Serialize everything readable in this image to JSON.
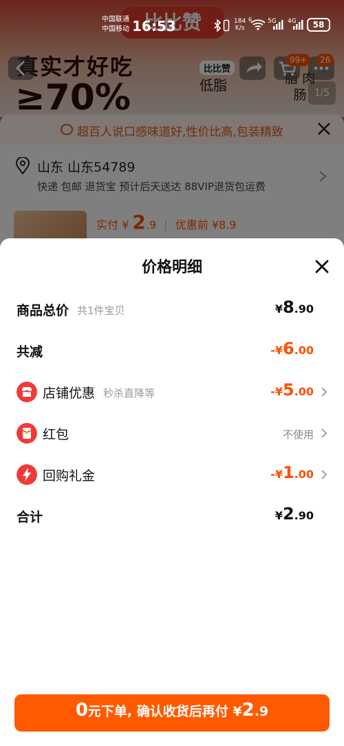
{
  "status_bar": {
    "carrier_1": "中国联通",
    "carrier_2": "中国移动",
    "time": "16:53",
    "net_speed_value": "184",
    "net_speed_unit": "K/s",
    "battery": "58",
    "network_1": "5G",
    "network_2": "4G",
    "wifi_badge": "6"
  },
  "background_page": {
    "hero_logo": "比比赞",
    "hero_slogan": "真实才好吃",
    "hero_percent": "≥70%",
    "hero_brand": "比比赞",
    "hero_tag_1": "低脂",
    "hero_tag_2": "脂 肉肠",
    "hero_pager": "1/5",
    "cart_badge": "99+",
    "more_badge": "26",
    "tip_text": "超百人说口感味道好,性价比高,包装精致",
    "address": "山东 山东54789",
    "shipping": "快递 包邮 退货宝 预计后天送达 88VIP退货包运费",
    "pay_label": "实付",
    "pay_yen": "¥",
    "pay_int": "2",
    "pay_dec": ".9",
    "pay_sep": "|",
    "before_discount": "优惠前 ¥8.9"
  },
  "sheet": {
    "title": "价格明细",
    "rows": [
      {
        "label": "商品总价",
        "sub": "共1件宝贝",
        "yen": "¥",
        "int": "8",
        "dec": ".90"
      },
      {
        "label": "共减",
        "yen": "-¥",
        "int": "6",
        "dec": ".00"
      },
      {
        "label": "店铺优惠",
        "sub": "秒杀直降等",
        "yen": "-¥",
        "int": "5",
        "dec": ".00"
      },
      {
        "label": "红包",
        "value_text": "不使用"
      },
      {
        "label": "回购礼金",
        "yen": "-¥",
        "int": "1",
        "dec": ".00"
      },
      {
        "label": "合计",
        "yen": "¥",
        "int": "2",
        "dec": ".90"
      }
    ]
  },
  "cta": {
    "zero": "0",
    "text": "元下单, 确认收货后再付",
    "yen": "¥",
    "int": "2",
    "dec": ".9"
  },
  "colors": {
    "accent": "#ff5000",
    "cta": "#ff5a00",
    "icon_red": "#f03a3a",
    "tip_bg": "#fff1e8"
  },
  "icons": [
    "back-icon",
    "share-icon",
    "cart-icon",
    "more-icon",
    "close-icon",
    "location-icon",
    "chevron-right-icon",
    "shop-icon",
    "red-packet-icon",
    "lightning-icon",
    "comment-icon"
  ]
}
